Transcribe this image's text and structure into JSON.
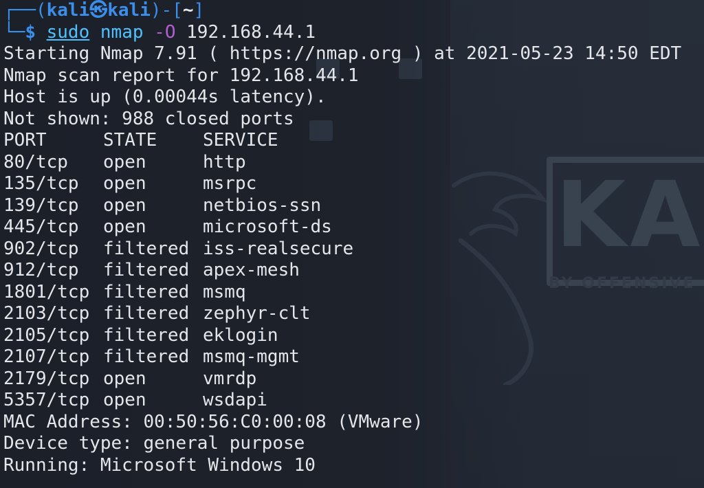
{
  "prompt": {
    "frame_top": "┌──(",
    "user": "kali㉿kali",
    "mid": ")-[",
    "dir": "~",
    "end": "]",
    "frame_bottom": "└─",
    "dollar": "$",
    "command": {
      "sudo": "sudo",
      "program": "nmap",
      "flag": "-O",
      "target": "192.168.44.1"
    }
  },
  "output": {
    "start_line": "Starting Nmap 7.91 ( https://nmap.org ) at 2021-05-23 14:50 EDT",
    "report_line": "Nmap scan report for 192.168.44.1",
    "host_line": "Host is up (0.00044s latency).",
    "not_shown_line": "Not shown: 988 closed ports",
    "table": {
      "headers": {
        "port": "PORT",
        "state": "STATE",
        "service": "SERVICE"
      },
      "rows": [
        {
          "port": "80/tcp",
          "state": "open",
          "service": "http"
        },
        {
          "port": "135/tcp",
          "state": "open",
          "service": "msrpc"
        },
        {
          "port": "139/tcp",
          "state": "open",
          "service": "netbios-ssn"
        },
        {
          "port": "445/tcp",
          "state": "open",
          "service": "microsoft-ds"
        },
        {
          "port": "902/tcp",
          "state": "filtered",
          "service": "iss-realsecure"
        },
        {
          "port": "912/tcp",
          "state": "filtered",
          "service": "apex-mesh"
        },
        {
          "port": "1801/tcp",
          "state": "filtered",
          "service": "msmq"
        },
        {
          "port": "2103/tcp",
          "state": "filtered",
          "service": "zephyr-clt"
        },
        {
          "port": "2105/tcp",
          "state": "filtered",
          "service": "eklogin"
        },
        {
          "port": "2107/tcp",
          "state": "filtered",
          "service": "msmq-mgmt"
        },
        {
          "port": "2179/tcp",
          "state": "open",
          "service": "vmrdp"
        },
        {
          "port": "5357/tcp",
          "state": "open",
          "service": "wsdapi"
        }
      ]
    },
    "mac_line": "MAC Address: 00:50:56:C0:00:08 (VMware)",
    "device_line": "Device type: general purpose",
    "running_line": "Running: Microsoft Windows 10"
  },
  "wallpaper": {
    "logo_text": "KALI",
    "tagline": "BY OFFENSIVE SECURITY"
  },
  "colors": {
    "background": "#1c2029",
    "text": "#e4e6ea",
    "prompt_blue": "#3b8eea",
    "command_cyan": "#4fc1ff",
    "flag_purple": "#b05fd0"
  }
}
